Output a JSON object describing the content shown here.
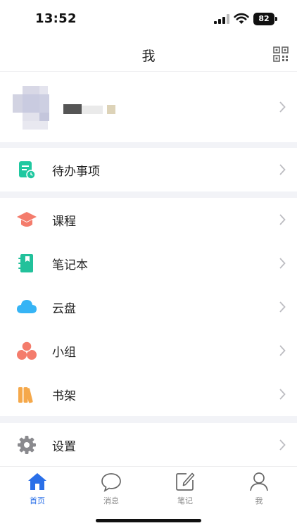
{
  "status_bar": {
    "time": "13:52",
    "battery": "82"
  },
  "nav": {
    "title": "我",
    "qr_icon": "qr-code-icon"
  },
  "profile": {
    "avatar_icon": "avatar",
    "name": ""
  },
  "todo": {
    "label": "待办事项",
    "icon": "todo-icon",
    "color": "#1fc8a0"
  },
  "menu": [
    {
      "label": "课程",
      "icon": "course-cap-icon",
      "color": "#f47c6c"
    },
    {
      "label": "笔记本",
      "icon": "notebook-icon",
      "color": "#22c19b"
    },
    {
      "label": "云盘",
      "icon": "cloud-icon",
      "color": "#36b4f5"
    },
    {
      "label": "小组",
      "icon": "group-icon",
      "color": "#f47c6c"
    },
    {
      "label": "书架",
      "icon": "bookshelf-icon",
      "color": "#f5a84a"
    }
  ],
  "settings": {
    "label": "设置",
    "icon": "gear-icon",
    "color": "#8a8a8e"
  },
  "tabs": [
    {
      "label": "首页",
      "icon": "home-icon",
      "active": true
    },
    {
      "label": "消息",
      "icon": "message-icon",
      "active": false
    },
    {
      "label": "笔记",
      "icon": "note-edit-icon",
      "active": false
    },
    {
      "label": "我",
      "icon": "person-icon",
      "active": false
    }
  ],
  "colors": {
    "accent": "#2a6fe8",
    "background_gap": "#f2f3f7"
  }
}
